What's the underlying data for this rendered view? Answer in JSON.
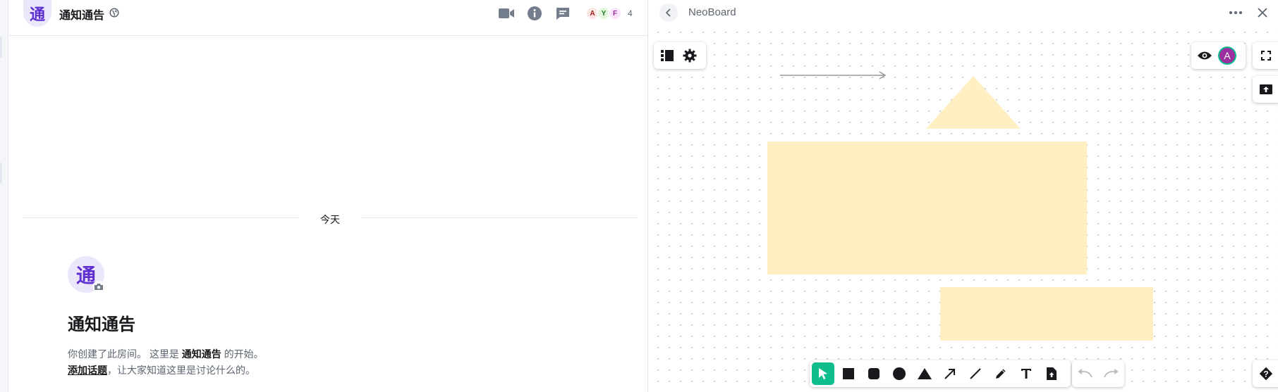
{
  "room": {
    "avatar_letter": "通",
    "name": "通知通告",
    "members": [
      {
        "initial": "A",
        "color": "#a0201a",
        "bg": "#ffe7e5"
      },
      {
        "initial": "Y",
        "color": "#1e7a1e",
        "bg": "#e3f7df"
      },
      {
        "initial": "F",
        "color": "#9b2fa0",
        "bg": "#fbe5fc"
      }
    ],
    "member_count": "4",
    "header_icons": [
      "video-call-icon",
      "room-info-icon",
      "threads-icon",
      "globe-icon"
    ],
    "date_divider": "今天",
    "intro": {
      "title": "通知通告",
      "line1_prefix": "你创建了此房间。 这里是 ",
      "line1_room": "通知通告",
      "line1_suffix": " 的开始。",
      "add_topic": "添加话题",
      "line2_suffix": "，让大家知道这里是讨论什么的。"
    }
  },
  "board": {
    "title": "NeoBoard",
    "accent": "#0dbd8b",
    "shape_fill": "#ffefc2",
    "presenter_initial": "A",
    "tools": [
      "select-tool-icon",
      "rectangle-tool-icon",
      "rounded-rectangle-tool-icon",
      "ellipse-tool-icon",
      "triangle-tool-icon",
      "arrow-tool-icon",
      "line-tool-icon",
      "pen-tool-icon",
      "text-tool-icon",
      "image-upload-tool-icon"
    ],
    "active_tool": "select-tool-icon",
    "history": [
      "undo-icon",
      "redo-icon"
    ],
    "corner_buttons": [
      "slide-list-icon",
      "settings-icon",
      "presenter-view-icon",
      "fullscreen-icon",
      "export-icon",
      "help-icon"
    ]
  }
}
